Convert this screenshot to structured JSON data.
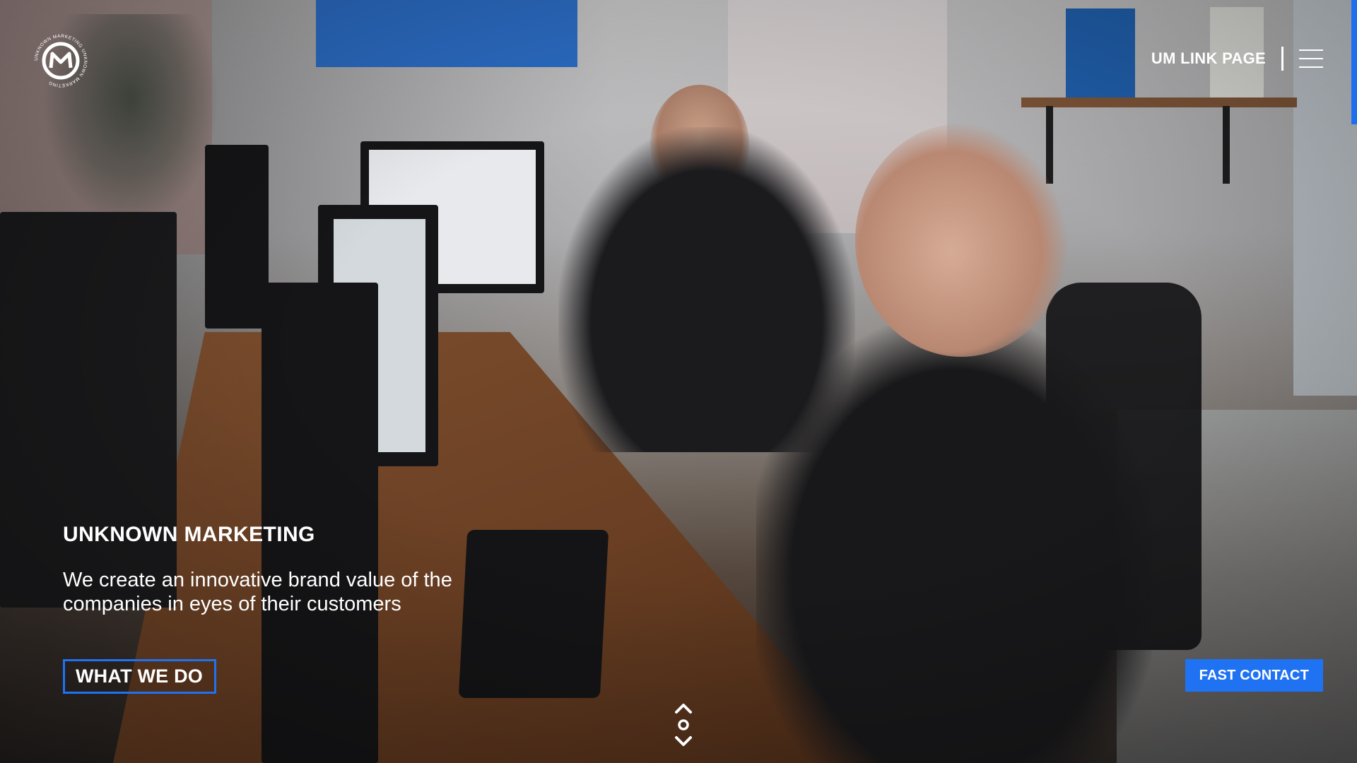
{
  "header": {
    "logo_ring_text": "UNKNOWN MARKETING UNKNOWN MARKETING",
    "link_page_label": "UM LINK PAGE"
  },
  "hero": {
    "title": "UNKNOWN MARKETING",
    "subtitle": "We create an innovative brand value of the companies in eyes of their customers",
    "primary_cta": "WHAT WE DO"
  },
  "floating": {
    "fast_contact_label": "FAST CONTACT"
  },
  "colors": {
    "accent": "#1f72f2",
    "text": "#ffffff"
  },
  "icons": {
    "logo": "um-logo-icon",
    "menu": "hamburger-menu-icon",
    "scroll": "scroll-indicator-icon"
  }
}
